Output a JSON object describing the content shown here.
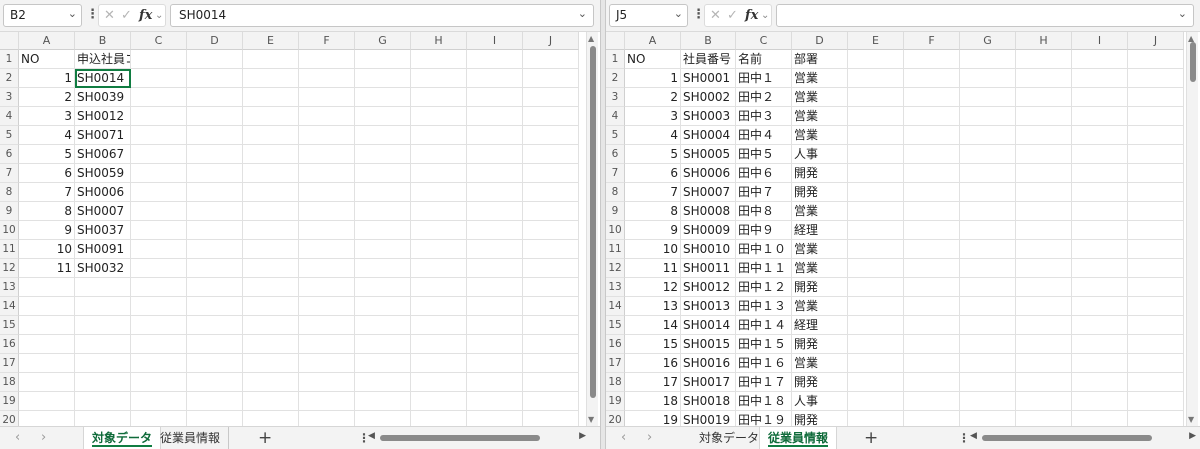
{
  "left": {
    "name_box": "B2",
    "formula": "SH0014",
    "columns": [
      "A",
      "B",
      "C",
      "D",
      "E",
      "F",
      "G",
      "H",
      "I",
      "J"
    ],
    "rows": [
      {
        "n": "1",
        "a": "NO",
        "b": "申込社員コード"
      },
      {
        "n": "2",
        "a": "1",
        "b": "SH0014"
      },
      {
        "n": "3",
        "a": "2",
        "b": "SH0039"
      },
      {
        "n": "4",
        "a": "3",
        "b": "SH0012"
      },
      {
        "n": "5",
        "a": "4",
        "b": "SH0071"
      },
      {
        "n": "6",
        "a": "5",
        "b": "SH0067"
      },
      {
        "n": "7",
        "a": "6",
        "b": "SH0059"
      },
      {
        "n": "8",
        "a": "7",
        "b": "SH0006"
      },
      {
        "n": "9",
        "a": "8",
        "b": "SH0007"
      },
      {
        "n": "10",
        "a": "9",
        "b": "SH0037"
      },
      {
        "n": "11",
        "a": "10",
        "b": "SH0091"
      },
      {
        "n": "12",
        "a": "11",
        "b": "SH0032"
      },
      {
        "n": "13",
        "a": "",
        "b": ""
      },
      {
        "n": "14",
        "a": "",
        "b": ""
      },
      {
        "n": "15",
        "a": "",
        "b": ""
      },
      {
        "n": "16",
        "a": "",
        "b": ""
      },
      {
        "n": "17",
        "a": "",
        "b": ""
      },
      {
        "n": "18",
        "a": "",
        "b": ""
      },
      {
        "n": "19",
        "a": "",
        "b": ""
      },
      {
        "n": "20",
        "a": "",
        "b": ""
      }
    ],
    "tabs": [
      "対象データ",
      "従業員情報"
    ],
    "active_tab": 0
  },
  "right": {
    "name_box": "J5",
    "formula": "",
    "columns": [
      "A",
      "B",
      "C",
      "D",
      "E",
      "F",
      "G",
      "H",
      "I",
      "J"
    ],
    "rows": [
      {
        "n": "1",
        "a": "NO",
        "b": "社員番号",
        "c": "名前",
        "d": "部署"
      },
      {
        "n": "2",
        "a": "1",
        "b": "SH0001",
        "c": "田中１",
        "d": "営業"
      },
      {
        "n": "3",
        "a": "2",
        "b": "SH0002",
        "c": "田中２",
        "d": "営業"
      },
      {
        "n": "4",
        "a": "3",
        "b": "SH0003",
        "c": "田中３",
        "d": "営業"
      },
      {
        "n": "5",
        "a": "4",
        "b": "SH0004",
        "c": "田中４",
        "d": "営業"
      },
      {
        "n": "6",
        "a": "5",
        "b": "SH0005",
        "c": "田中５",
        "d": "人事"
      },
      {
        "n": "7",
        "a": "6",
        "b": "SH0006",
        "c": "田中６",
        "d": "開発"
      },
      {
        "n": "8",
        "a": "7",
        "b": "SH0007",
        "c": "田中７",
        "d": "開発"
      },
      {
        "n": "9",
        "a": "8",
        "b": "SH0008",
        "c": "田中８",
        "d": "営業"
      },
      {
        "n": "10",
        "a": "9",
        "b": "SH0009",
        "c": "田中９",
        "d": "経理"
      },
      {
        "n": "11",
        "a": "10",
        "b": "SH0010",
        "c": "田中１０",
        "d": "営業"
      },
      {
        "n": "12",
        "a": "11",
        "b": "SH0011",
        "c": "田中１１",
        "d": "営業"
      },
      {
        "n": "13",
        "a": "12",
        "b": "SH0012",
        "c": "田中１２",
        "d": "開発"
      },
      {
        "n": "14",
        "a": "13",
        "b": "SH0013",
        "c": "田中１３",
        "d": "営業"
      },
      {
        "n": "15",
        "a": "14",
        "b": "SH0014",
        "c": "田中１４",
        "d": "経理"
      },
      {
        "n": "16",
        "a": "15",
        "b": "SH0015",
        "c": "田中１５",
        "d": "開発"
      },
      {
        "n": "17",
        "a": "16",
        "b": "SH0016",
        "c": "田中１６",
        "d": "営業"
      },
      {
        "n": "18",
        "a": "17",
        "b": "SH0017",
        "c": "田中１７",
        "d": "開発"
      },
      {
        "n": "19",
        "a": "18",
        "b": "SH0018",
        "c": "田中１８",
        "d": "人事"
      },
      {
        "n": "20",
        "a": "19",
        "b": "SH0019",
        "c": "田中１９",
        "d": "開発"
      }
    ],
    "tabs": [
      "対象データ",
      "従業員情報"
    ],
    "active_tab": 1
  },
  "icons": {
    "cancel": "✕",
    "enter": "✓",
    "fx": "fx",
    "dropdown": "⌄",
    "dots": "⋮",
    "prev": "‹",
    "next": "›",
    "add": "+",
    "left_arrow": "◀",
    "right_arrow": "▶"
  }
}
